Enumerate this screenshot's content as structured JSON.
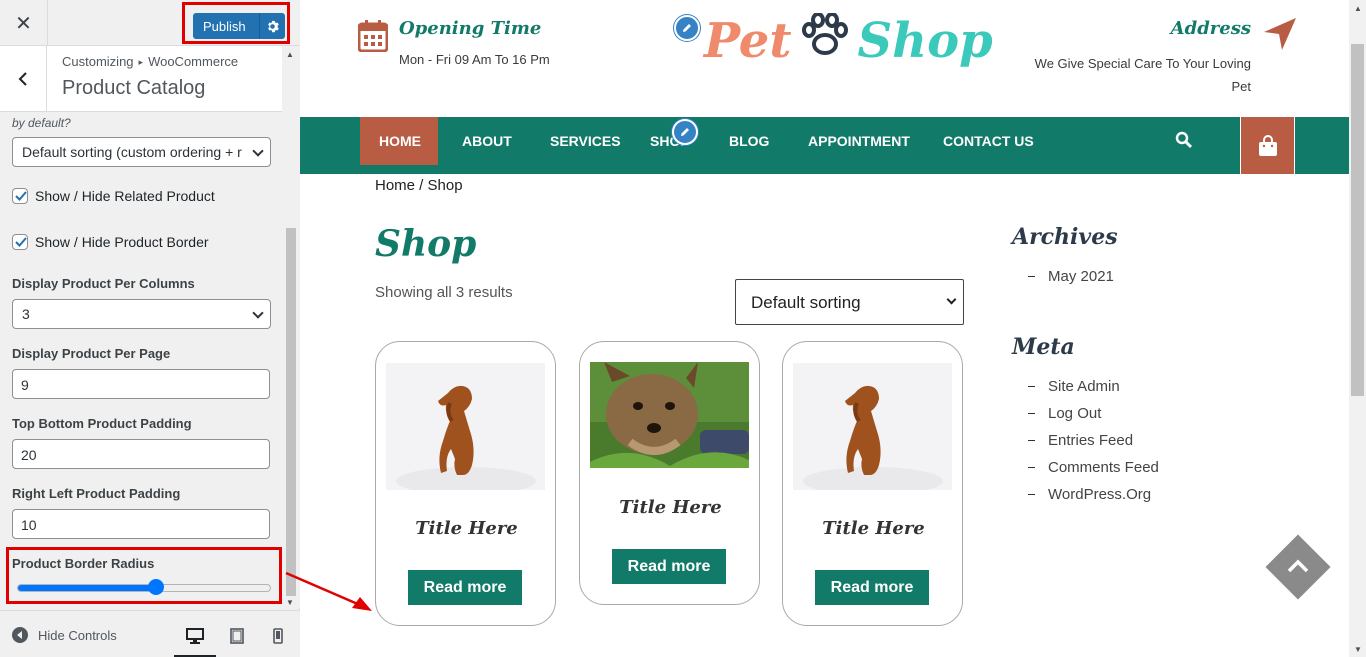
{
  "customizer": {
    "publish_label": "Publish",
    "breadcrumb": [
      "Customizing",
      "WooCommerce"
    ],
    "section_title": "Product Catalog",
    "partial_label": "by default?",
    "default_sorting_value": "Default sorting (custom ordering + r",
    "related_label": "Show / Hide Related Product",
    "related_checked": true,
    "border_label": "Show / Hide Product Border",
    "border_checked": true,
    "per_columns_label": "Display Product Per Columns",
    "per_columns_value": "3",
    "per_page_label": "Display Product Per Page",
    "per_page_value": "9",
    "tb_padding_label": "Top Bottom Product Padding",
    "tb_padding_value": "20",
    "rl_padding_label": "Right Left Product Padding",
    "rl_padding_value": "10",
    "radius_label": "Product Border Radius",
    "radius_level": 0.55,
    "hide_controls_label": "Hide Controls",
    "devices": [
      "desktop-icon",
      "tablet-icon",
      "mobile-icon"
    ]
  },
  "site": {
    "opening_title": "Opening Time",
    "opening_text": "Mon - Fri 09 Am To 16 Pm",
    "logo_part1": "Pet",
    "logo_part2": "Shop",
    "address_title": "Address",
    "address_text_line1": "We Give Special Care To Your Loving",
    "address_text_line2": "Pet",
    "nav": [
      "HOME",
      "ABOUT",
      "SERVICES",
      "SHOP",
      "BLOG",
      "APPOINTMENT",
      "CONTACT US"
    ],
    "breadcrumb": "Home / Shop",
    "shop_title": "Shop",
    "results_text": "Showing all 3 results",
    "sort_value": "Default sorting",
    "products": [
      {
        "title": "Title Here",
        "button": "Read more"
      },
      {
        "title": "Title Here",
        "button": "Read more"
      },
      {
        "title": "Title Here",
        "button": "Read more"
      }
    ],
    "archives_title": "Archives",
    "archives": [
      "May 2021"
    ],
    "meta_title": "Meta",
    "meta": [
      "Site Admin",
      "Log Out",
      "Entries Feed",
      "Comments Feed",
      "WordPress.Org"
    ]
  },
  "colors": {
    "primary": "#127a68",
    "accent": "#b85c44",
    "publish": "#2271b1",
    "highlight": "#e00000"
  }
}
